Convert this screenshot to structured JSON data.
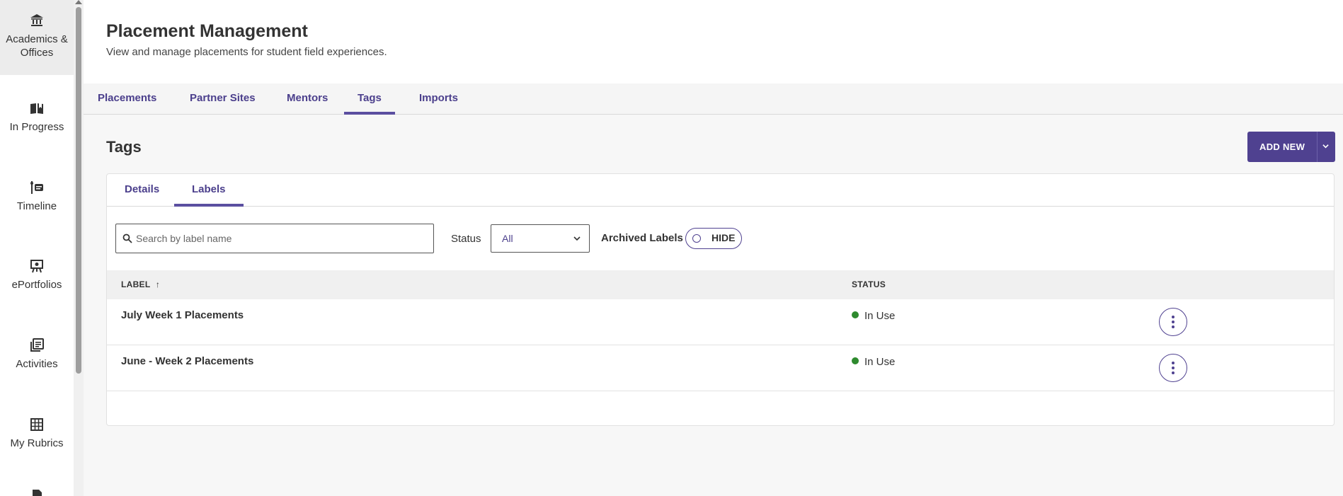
{
  "sidebar": {
    "items": [
      {
        "label": "Academics & Offices",
        "icon": "bank-icon",
        "active": true
      },
      {
        "label": "In Progress",
        "icon": "book-flag-icon"
      },
      {
        "label": "Timeline",
        "icon": "timeline-icon"
      },
      {
        "label": "ePortfolios",
        "icon": "easel-icon"
      },
      {
        "label": "Activities",
        "icon": "activities-icon"
      },
      {
        "label": "My Rubrics",
        "icon": "grid-icon"
      }
    ]
  },
  "header": {
    "title": "Placement Management",
    "subtitle": "View and manage placements for student field experiences."
  },
  "tabs": [
    "Placements",
    "Partner Sites",
    "Mentors",
    "Tags",
    "Imports"
  ],
  "active_tab": "Tags",
  "section": {
    "title": "Tags",
    "add_new_label": "ADD NEW"
  },
  "inner_tabs": [
    "Details",
    "Labels"
  ],
  "active_inner_tab": "Labels",
  "filters": {
    "search_placeholder": "Search by label name",
    "search_value": "",
    "status_label": "Status",
    "status_value": "All",
    "archived_label": "Archived Labels",
    "archived_toggle": "HIDE"
  },
  "table": {
    "columns": [
      "LABEL",
      "STATUS"
    ],
    "sort_indicator": "↑",
    "rows": [
      {
        "label": "July Week 1 Placements",
        "status": "In Use"
      },
      {
        "label": "June - Week 2 Placements",
        "status": "In Use"
      }
    ]
  },
  "colors": {
    "accent": "#4f4190",
    "status_in_use": "#2e8a2e"
  }
}
